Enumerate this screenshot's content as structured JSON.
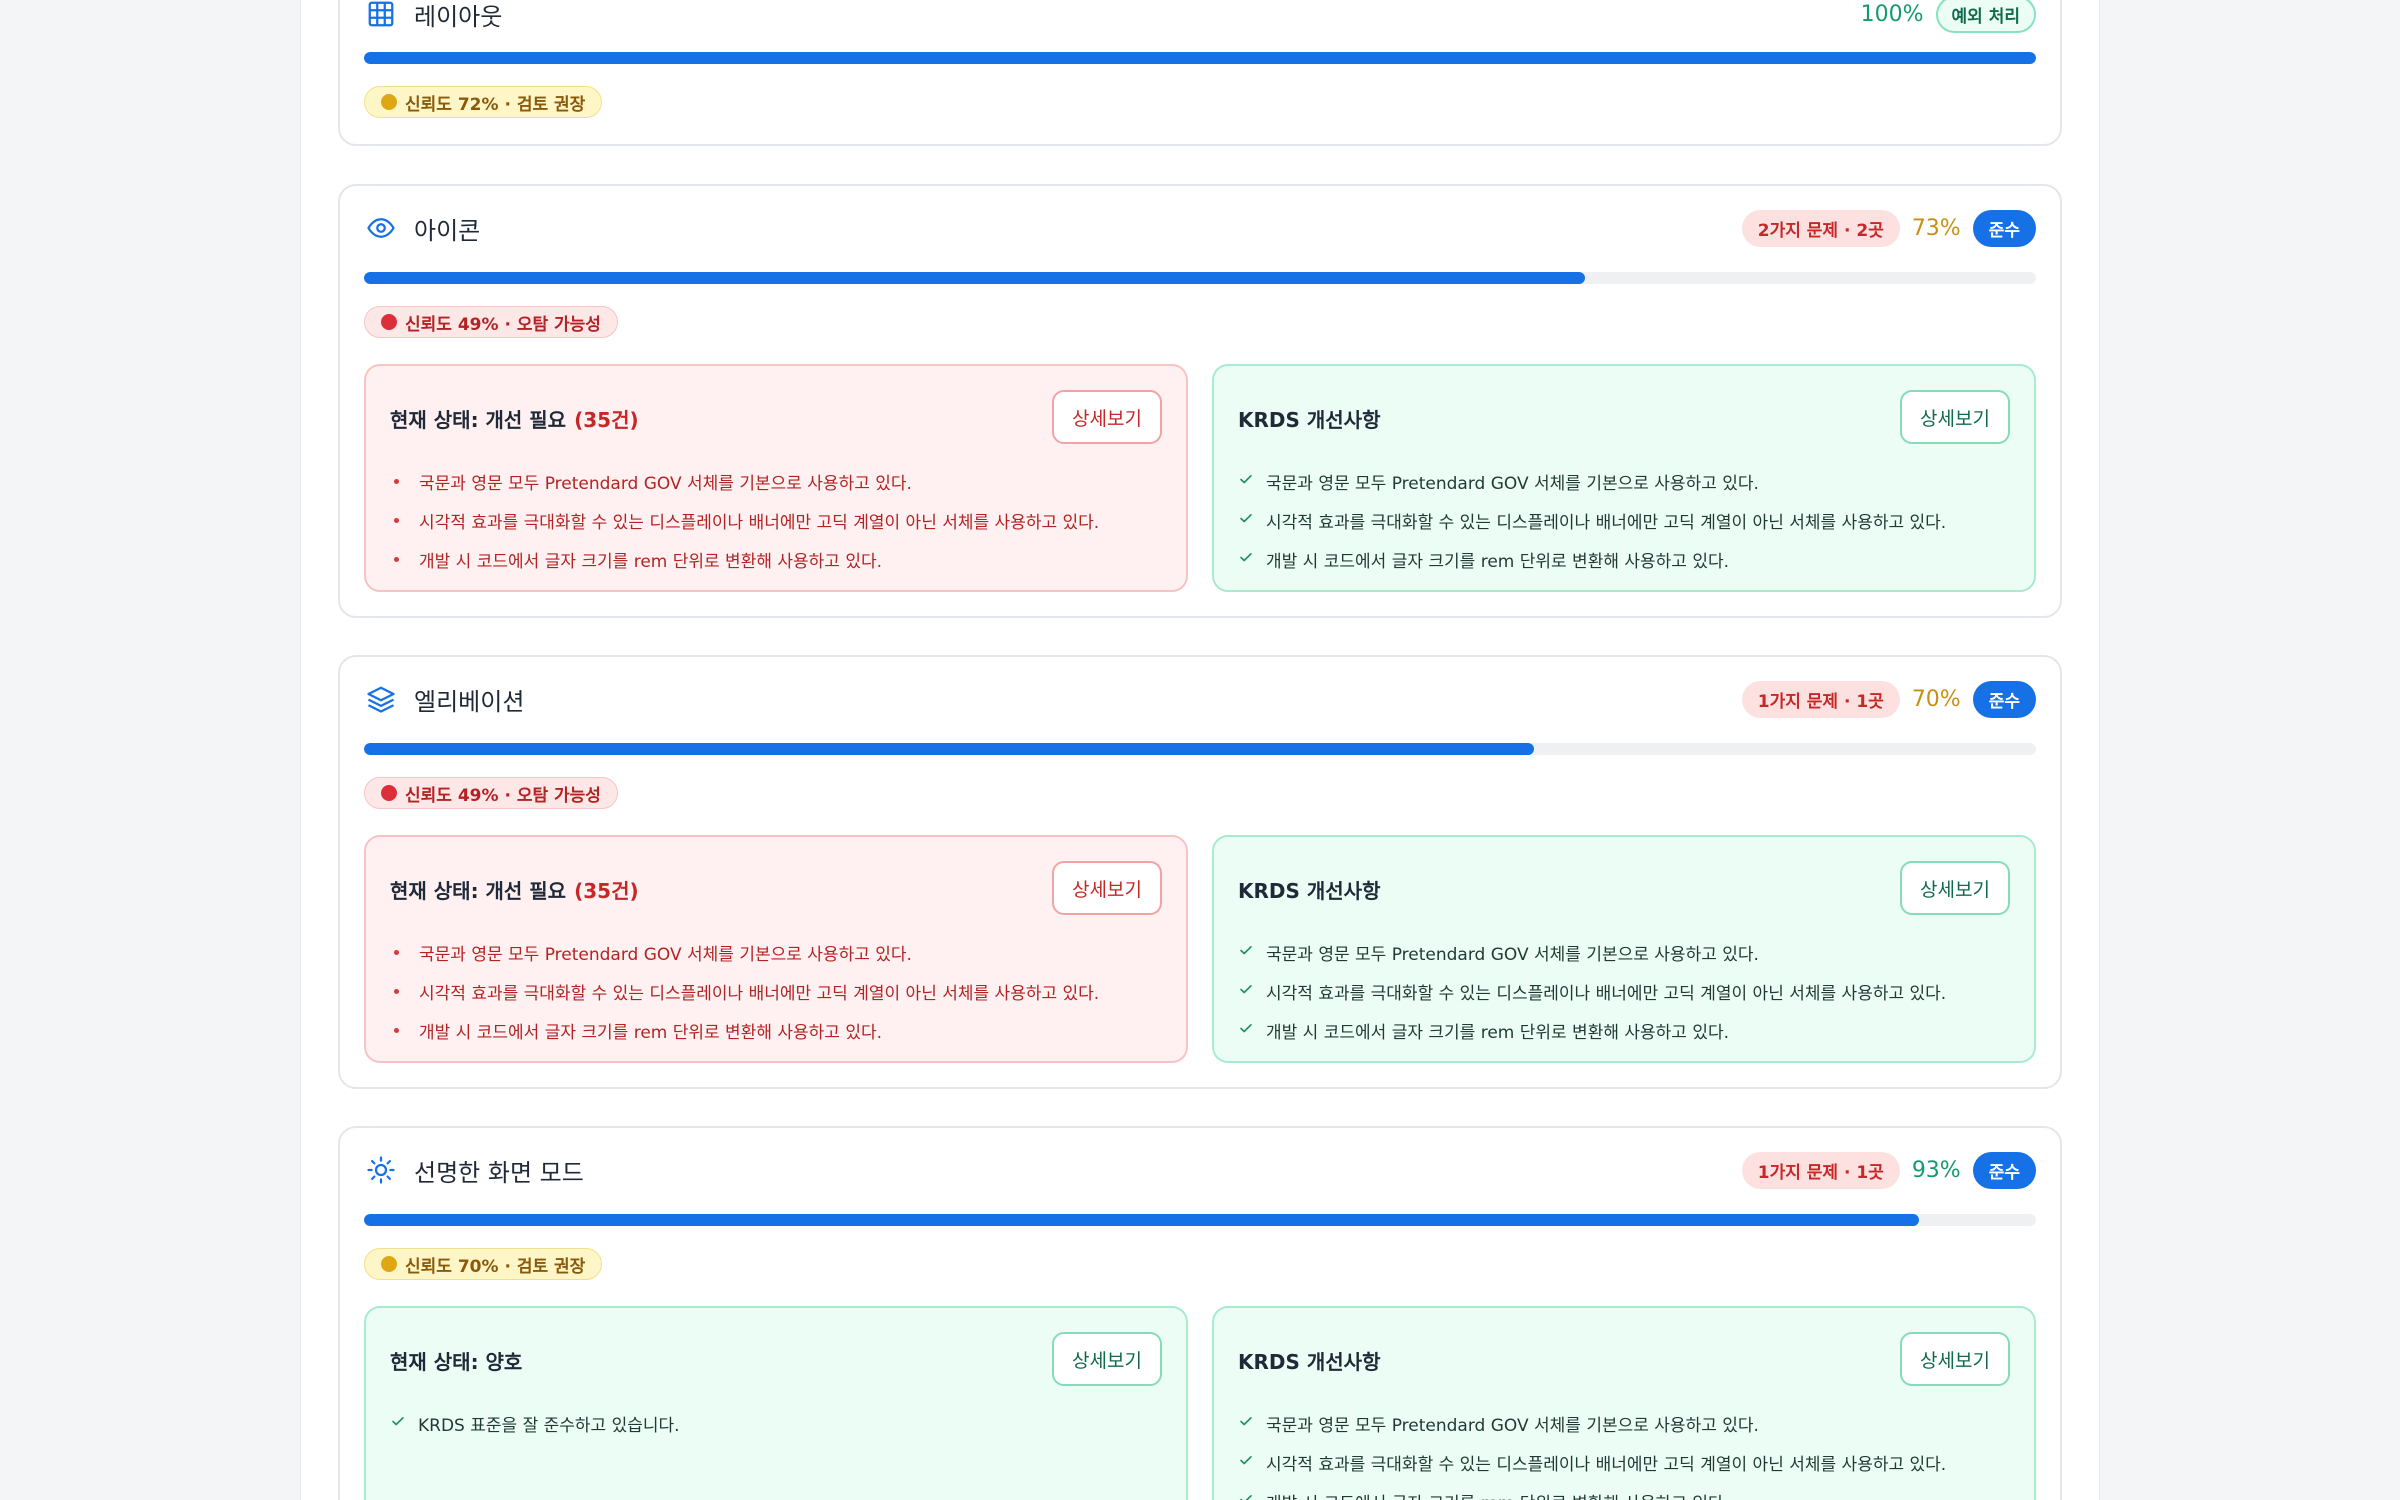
{
  "colors": {
    "accent": "#1670e6",
    "issue": "#c62828",
    "warn": "#c79012",
    "good": "#159a6e"
  },
  "sections": [
    {
      "icon": "grid-icon",
      "title": "레이아웃",
      "score": "100%",
      "status_badge": "예외 처리",
      "progress": 1.0,
      "confidence": "신뢰도 72% · 검토 권장"
    },
    {
      "icon": "eye-icon",
      "title": "아이콘",
      "issues": "2가지 문제 · 2곳",
      "score": "73%",
      "status_badge": "준수",
      "progress": 0.73,
      "confidence": "신뢰도 49% · 오탐 가능성",
      "current": {
        "title": "현재 상태: 개선 필요",
        "count": "(35건)",
        "button": "상세보기",
        "items": [
          "국문과 영문 모두 Pretendard GOV 서체를 기본으로 사용하고 있다.",
          "시각적 효과를 극대화할 수 있는 디스플레이나 배너에만 고딕 계열이 아닌 서체를 사용하고 있다.",
          "개발 시 코드에서 글자 크기를 rem 단위로 변환해 사용하고 있다."
        ]
      },
      "krds": {
        "title": "KRDS 개선사항",
        "button": "상세보기",
        "items": [
          "국문과 영문 모두 Pretendard GOV 서체를 기본으로 사용하고 있다.",
          "시각적 효과를 극대화할 수 있는 디스플레이나 배너에만 고딕 계열이 아닌 서체를 사용하고 있다.",
          "개발 시 코드에서 글자 크기를 rem 단위로 변환해 사용하고 있다."
        ]
      }
    },
    {
      "icon": "layers-icon",
      "title": "엘리베이션",
      "issues": "1가지 문제 · 1곳",
      "score": "70%",
      "status_badge": "준수",
      "progress": 0.7,
      "confidence": "신뢰도 49% · 오탐 가능성",
      "current": {
        "title": "현재 상태: 개선 필요",
        "count": "(35건)",
        "button": "상세보기",
        "items": [
          "국문과 영문 모두 Pretendard GOV 서체를 기본으로 사용하고 있다.",
          "시각적 효과를 극대화할 수 있는 디스플레이나 배너에만 고딕 계열이 아닌 서체를 사용하고 있다.",
          "개발 시 코드에서 글자 크기를 rem 단위로 변환해 사용하고 있다."
        ]
      },
      "krds": {
        "title": "KRDS 개선사항",
        "button": "상세보기",
        "items": [
          "국문과 영문 모두 Pretendard GOV 서체를 기본으로 사용하고 있다.",
          "시각적 효과를 극대화할 수 있는 디스플레이나 배너에만 고딕 계열이 아닌 서체를 사용하고 있다.",
          "개발 시 코드에서 글자 크기를 rem 단위로 변환해 사용하고 있다."
        ]
      }
    },
    {
      "icon": "sun-icon",
      "title": "선명한 화면 모드",
      "issues": "1가지 문제 · 1곳",
      "score": "93%",
      "status_badge": "준수",
      "progress": 0.93,
      "confidence": "신뢰도 70% · 검토 권장",
      "current": {
        "title": "현재 상태: 양호",
        "button": "상세보기",
        "items": [
          "KRDS 표준을 잘 준수하고 있습니다."
        ]
      },
      "krds": {
        "title": "KRDS 개선사항",
        "button": "상세보기",
        "items": [
          "국문과 영문 모두 Pretendard GOV 서체를 기본으로 사용하고 있다.",
          "시각적 효과를 극대화할 수 있는 디스플레이나 배너에만 고딕 계열이 아닌 서체를 사용하고 있다.",
          "개발 시 코드에서 글자 크기를 rem 단위로 변환해 사용하고 있다."
        ]
      }
    }
  ]
}
